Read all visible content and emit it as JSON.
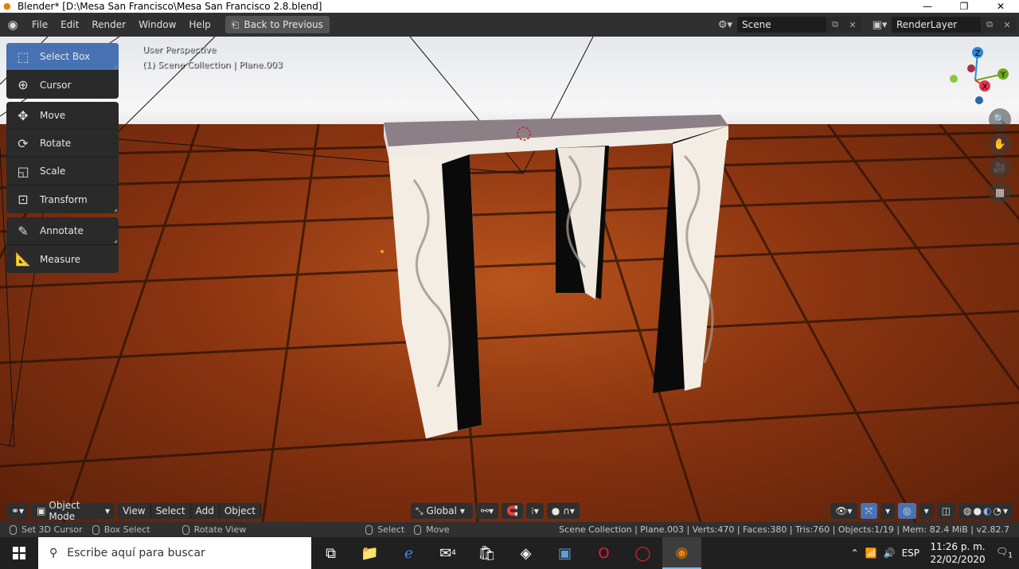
{
  "window": {
    "title": "Blender* [D:\\Mesa San Francisco\\Mesa San Francisco 2.8.blend]"
  },
  "topbar": {
    "menus": [
      "File",
      "Edit",
      "Render",
      "Window",
      "Help"
    ],
    "back_label": "Back to Previous",
    "scene_value": "Scene",
    "renderlayer_value": "RenderLayer"
  },
  "viewport": {
    "perspective_label": "User Perspective",
    "collection_label": "(1) Scene Collection | Plane.003"
  },
  "toolbar": {
    "group1": [
      {
        "label": "Select Box",
        "icon": "select-box-icon",
        "active": true
      },
      {
        "label": "Cursor",
        "icon": "cursor-icon"
      }
    ],
    "group2": [
      {
        "label": "Move",
        "icon": "move-icon"
      },
      {
        "label": "Rotate",
        "icon": "rotate-icon"
      },
      {
        "label": "Scale",
        "icon": "scale-icon"
      },
      {
        "label": "Transform",
        "icon": "transform-icon"
      }
    ],
    "group3": [
      {
        "label": "Annotate",
        "icon": "annotate-icon"
      },
      {
        "label": "Measure",
        "icon": "measure-icon"
      }
    ]
  },
  "gizmo": {
    "x": "X",
    "y": "Y",
    "z": "Z"
  },
  "viewport_header": {
    "mode": "Object Mode",
    "menus": [
      "View",
      "Select",
      "Add",
      "Object"
    ],
    "orientation": "Global"
  },
  "statusbar": {
    "items": [
      "Set 3D Cursor",
      "Box Select",
      "Rotate View",
      "Select",
      "Move"
    ],
    "info": "Scene Collection | Plane.003 | Verts:470 | Faces:380 | Tris:760 | Objects:1/19 | Mem: 82.4 MiB | v2.82.7"
  },
  "taskbar": {
    "search_placeholder": "Escribe aquí para buscar",
    "mail_badge": "4",
    "language": "ESP",
    "time": "11:26 p. m.",
    "date": "22/02/2020",
    "notification_count": "1"
  },
  "colors": {
    "accent": "#4772b3",
    "blender_orange": "#e87d0d",
    "axis_x": "#e5304a",
    "axis_y": "#6ea61e",
    "axis_z": "#2b88d8"
  }
}
